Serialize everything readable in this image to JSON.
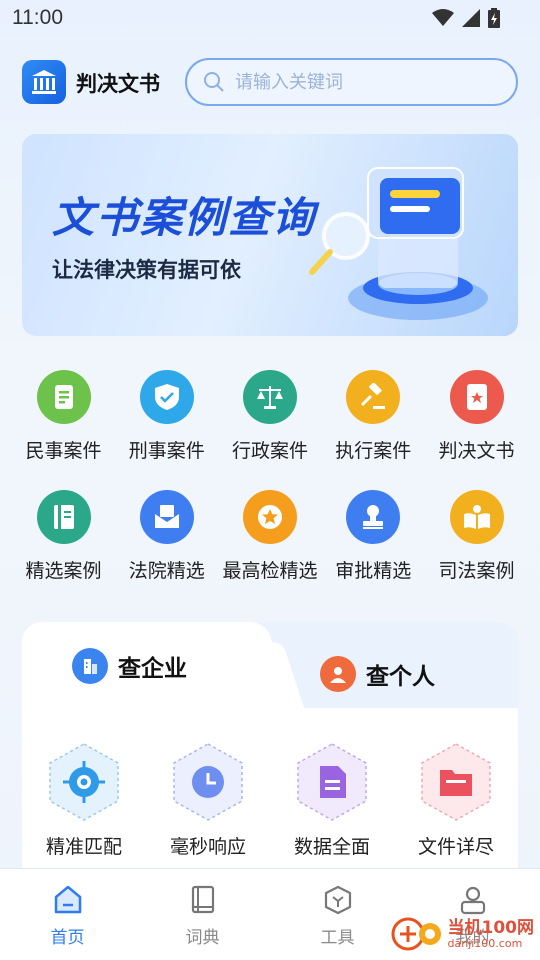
{
  "status_bar": {
    "time": "11:00"
  },
  "header": {
    "app_title": "判决文书",
    "search_placeholder": "请输入关键词"
  },
  "banner": {
    "title": "文书案例查询",
    "subtitle": "让法律决策有据可依"
  },
  "categories": [
    {
      "label": "民事案件",
      "icon": "document-icon",
      "color": "#6cc24a"
    },
    {
      "label": "刑事案件",
      "icon": "shield-check-icon",
      "color": "#2ea8e8"
    },
    {
      "label": "行政案件",
      "icon": "scales-icon",
      "color": "#2aa889"
    },
    {
      "label": "执行案件",
      "icon": "gavel-icon",
      "color": "#f2b01e"
    },
    {
      "label": "判决文书",
      "icon": "star-document-icon",
      "color": "#ec5a4d"
    },
    {
      "label": "精选案例",
      "icon": "book-icon",
      "color": "#2aa889"
    },
    {
      "label": "法院精选",
      "icon": "mail-icon",
      "color": "#3e7ef0"
    },
    {
      "label": "最高检精选",
      "icon": "star-badge-icon",
      "color": "#f59d1c"
    },
    {
      "label": "审批精选",
      "icon": "stamp-icon",
      "color": "#3e7ef0"
    },
    {
      "label": "司法案例",
      "icon": "open-book-icon",
      "color": "#f2b01e"
    }
  ],
  "tabs": {
    "company": "查企业",
    "person": "查个人"
  },
  "features": [
    {
      "label": "精准匹配",
      "icon": "target-icon",
      "color": "#2f9be8"
    },
    {
      "label": "毫秒响应",
      "icon": "clock-icon",
      "color": "#6f8ff0"
    },
    {
      "label": "数据全面",
      "icon": "file-icon",
      "color": "#9a63e0"
    },
    {
      "label": "文件详尽",
      "icon": "folder-icon",
      "color": "#ec5160"
    }
  ],
  "bottom_nav": [
    {
      "label": "首页",
      "icon": "home-icon",
      "active": true
    },
    {
      "label": "词典",
      "icon": "dictionary-icon",
      "active": false
    },
    {
      "label": "工具",
      "icon": "tool-cube-icon",
      "active": false
    },
    {
      "label": "我的",
      "icon": "profile-icon",
      "active": false
    }
  ],
  "watermark": {
    "text": "当机100网",
    "url": "danji100.com"
  }
}
